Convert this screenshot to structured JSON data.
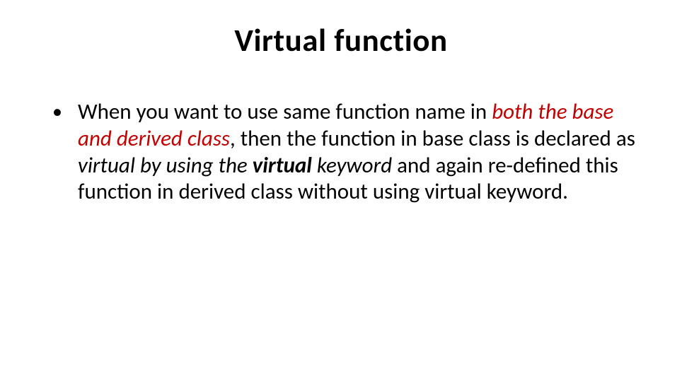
{
  "title": "Virtual function",
  "bullet": {
    "seg1": "When you want to use same function name in ",
    "seg2": "both the base and derived class",
    "seg3": ", then the function in base class is declared as ",
    "seg4": "virtual by using the ",
    "seg5": "virtual",
    "seg6": " keyword",
    "seg7": " and again re-defined this function in derived class without using virtual keyword."
  }
}
